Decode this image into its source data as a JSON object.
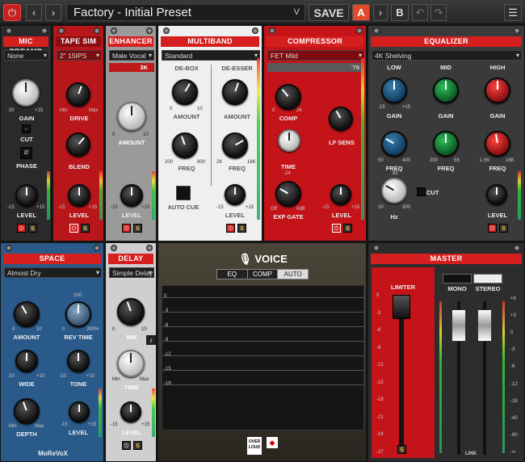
{
  "topbar": {
    "preset": "Factory - Initial Preset",
    "save": "SAVE",
    "a": "A",
    "b": "B",
    "prev": "‹",
    "next": "›",
    "chev": "V",
    "undo": "↶",
    "redo": "↷",
    "menu": "☰",
    "power": "⏻"
  },
  "mic": {
    "title": "MIC PREAMP",
    "sel": "None",
    "gain": "GAIN",
    "gmin": "-30",
    "gmax": "+15",
    "cut": "CUT",
    "phase": "PHASE",
    "level": "LEVEL",
    "lmin": "-15",
    "lmax": "+15"
  },
  "tape": {
    "title": "TAPE SIM",
    "sel": "2\" 15IPS",
    "drive": "DRIVE",
    "min": "Min",
    "max": "Max",
    "blend": "BLEND",
    "level": "LEVEL",
    "lmin": "-15",
    "lmax": "+15"
  },
  "enh": {
    "title": "ENHANCER",
    "sel": "Male Vocal",
    "freq": "3K",
    "amount": "AMOUNT",
    "amin": "0",
    "amax": "10",
    "level": "LEVEL",
    "lmin": "-15",
    "lmax": "+15"
  },
  "multi": {
    "title": "MULTIBAND",
    "sel": "Standard",
    "debox": "DE-BOX",
    "deesser": "DE-ESSER",
    "amount": "AMOUNT",
    "freq": "FREQ",
    "f1min": "200",
    "f1max": "800",
    "f2min": "2K",
    "f2max": "16K",
    "amin": "0",
    "amax": "10",
    "autocue": "AUTO CUE",
    "level": "LEVEL",
    "lmin": "-15",
    "lmax": "+15"
  },
  "comp": {
    "title": "COMPRESSOR",
    "sel": "FET Mild",
    "model": "'76",
    "comp": "COMP",
    "cmin": "0",
    "cmax": "24",
    "lfsens": "LF SENS",
    "time": "TIME",
    "tval": "-24",
    "expgate": "EXP GATE",
    "emin": "Off",
    "emax": "0dB",
    "level": "LEVEL",
    "lmin": "-15",
    "lmax": "+15"
  },
  "eq": {
    "title": "EQUALIZER",
    "sel": "4K Shelving",
    "low": "LOW",
    "mid": "MID",
    "high": "HIGH",
    "gain": "GAIN",
    "freq": "FREQ",
    "gmin": "-15",
    "gmax": "+15",
    "f1": "50",
    "f1m": "400",
    "f2": "200",
    "f2m": "5K",
    "f3": "1.5K",
    "f3m": "16K",
    "cut": "CUT",
    "hz": "Hz",
    "hzmin": "20",
    "hzmax": "300",
    "hz80": "80",
    "level": "LEVEL"
  },
  "space": {
    "title": "SPACE",
    "sel": "Almost Dry",
    "amount": "AMOUNT",
    "revtime": "REV TIME",
    "a0": "0",
    "a10": "10",
    "r0": "0",
    "r200": "200%",
    "r100": "100",
    "wide": "WIDE",
    "tone": "TONE",
    "wmin": "-10",
    "wmax": "+10",
    "tmin": "-10",
    "tmax": "+10",
    "depth": "DEPTH",
    "dmin": "Min",
    "dmax": "Max",
    "level": "LEVEL",
    "lmin": "-15",
    "lmax": "+15",
    "brand": "MoReVoX"
  },
  "delay": {
    "title": "DELAY",
    "sel": "Simple Delay",
    "mix": "MIX",
    "m0": "0",
    "m10": "10",
    "time": "TIME",
    "tmin": "Min",
    "tmax": "Max",
    "level": "LEVEL",
    "lmin": "-15",
    "lmax": "+15",
    "note": "♪"
  },
  "voice": {
    "title": "VOICE",
    "tabs": [
      "EQ",
      "COMP",
      "AUTO"
    ],
    "scale": [
      "0",
      "-3",
      "-6",
      "-9",
      "-12",
      "-15",
      "-18"
    ],
    "logo": "OVER LOUD"
  },
  "master": {
    "title": "MASTER",
    "limiter": "LIMITER",
    "mono": "MONO",
    "stereo": "STEREO",
    "lscale": [
      "0",
      "-3",
      "-6",
      "-9",
      "-12",
      "-15",
      "-18",
      "-21",
      "-24",
      "-27"
    ],
    "rscale": [
      "+6",
      "+3",
      "0",
      "-3",
      "-6",
      "-12",
      "-18",
      "-40",
      "-60",
      "-∞"
    ],
    "s": "S",
    "link": "LINK"
  },
  "colors": {
    "accent": "#d51f1f",
    "a_active": "#e04a2a"
  }
}
